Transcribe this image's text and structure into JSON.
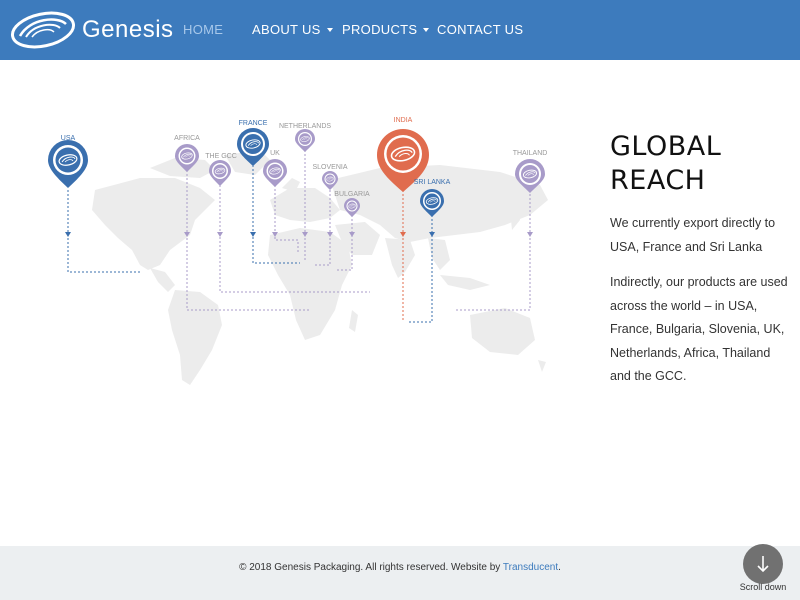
{
  "header": {
    "brand": "Genesis",
    "nav": [
      {
        "label": "HOME",
        "active": true,
        "dropdown": false
      },
      {
        "label": "ABOUT US",
        "active": false,
        "dropdown": true
      },
      {
        "label": "PRODUCTS",
        "active": false,
        "dropdown": true
      },
      {
        "label": "CONTACT US",
        "active": false,
        "dropdown": false
      }
    ]
  },
  "colors": {
    "nav_bg": "#3d7bbd",
    "pin_blue": "#3a6fae",
    "pin_purple": "#a89bc9",
    "pin_orange": "#e06c4e",
    "map_land": "#ececec",
    "footer_bg": "#eceff1"
  },
  "map": {
    "pins": [
      {
        "label": "USA",
        "style": "blue-large"
      },
      {
        "label": "AFRICA",
        "style": "purple"
      },
      {
        "label": "THE GCC",
        "style": "purple"
      },
      {
        "label": "FRANCE",
        "style": "blue-large"
      },
      {
        "label": "UK",
        "style": "purple"
      },
      {
        "label": "NETHERLANDS",
        "style": "purple"
      },
      {
        "label": "SLOVENIA",
        "style": "purple-small"
      },
      {
        "label": "BULGARIA",
        "style": "purple-small"
      },
      {
        "label": "INDIA",
        "style": "orange-large"
      },
      {
        "label": "SRI LANKA",
        "style": "blue"
      },
      {
        "label": "THAILAND",
        "style": "purple"
      }
    ]
  },
  "info": {
    "title_line1": "GLOBAL",
    "title_line2": "REACH",
    "paragraph1": "We currently export directly to USA, France and Sri Lanka",
    "paragraph2": "Indirectly, our products are used across the world – in USA, France, Bulgaria, Slovenia, UK, Netherlands, Africa, Thailand and the GCC."
  },
  "footer": {
    "text_before": "© 2018 Genesis Packaging. All rights reserved. Website by ",
    "link": "Transducent",
    "text_after": "."
  },
  "scroll": {
    "label": "Scroll down",
    "icon": "arrow-down-icon"
  }
}
